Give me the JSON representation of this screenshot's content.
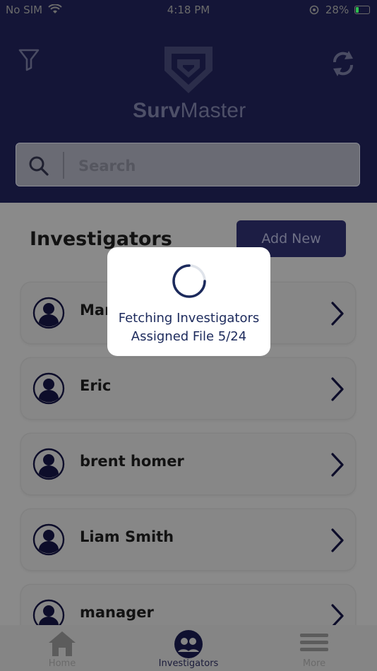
{
  "status_bar": {
    "carrier": "No SIM",
    "time": "4:18 PM",
    "battery": "28%"
  },
  "header": {
    "logo_bold": "Surv",
    "logo_light": "Master",
    "search_placeholder": "Search"
  },
  "section": {
    "title": "Investigators",
    "add_button": "Add New"
  },
  "investigators": [
    {
      "name": "Mar"
    },
    {
      "name": "Eric"
    },
    {
      "name": "brent homer"
    },
    {
      "name": "Liam Smith"
    },
    {
      "name": "manager"
    }
  ],
  "tabs": [
    {
      "label": "Home",
      "icon": "home-icon"
    },
    {
      "label": "Investigators",
      "icon": "investigators-icon"
    },
    {
      "label": "More",
      "icon": "menu-icon"
    }
  ],
  "modal": {
    "line1": "Fetching Investigators",
    "line2": "Assigned File 5/24"
  },
  "colors": {
    "header_bg": "#141537",
    "accent": "#1c1d44",
    "overlay_bg": "#8a8a8a",
    "modal_text": "#1c2a5c"
  }
}
